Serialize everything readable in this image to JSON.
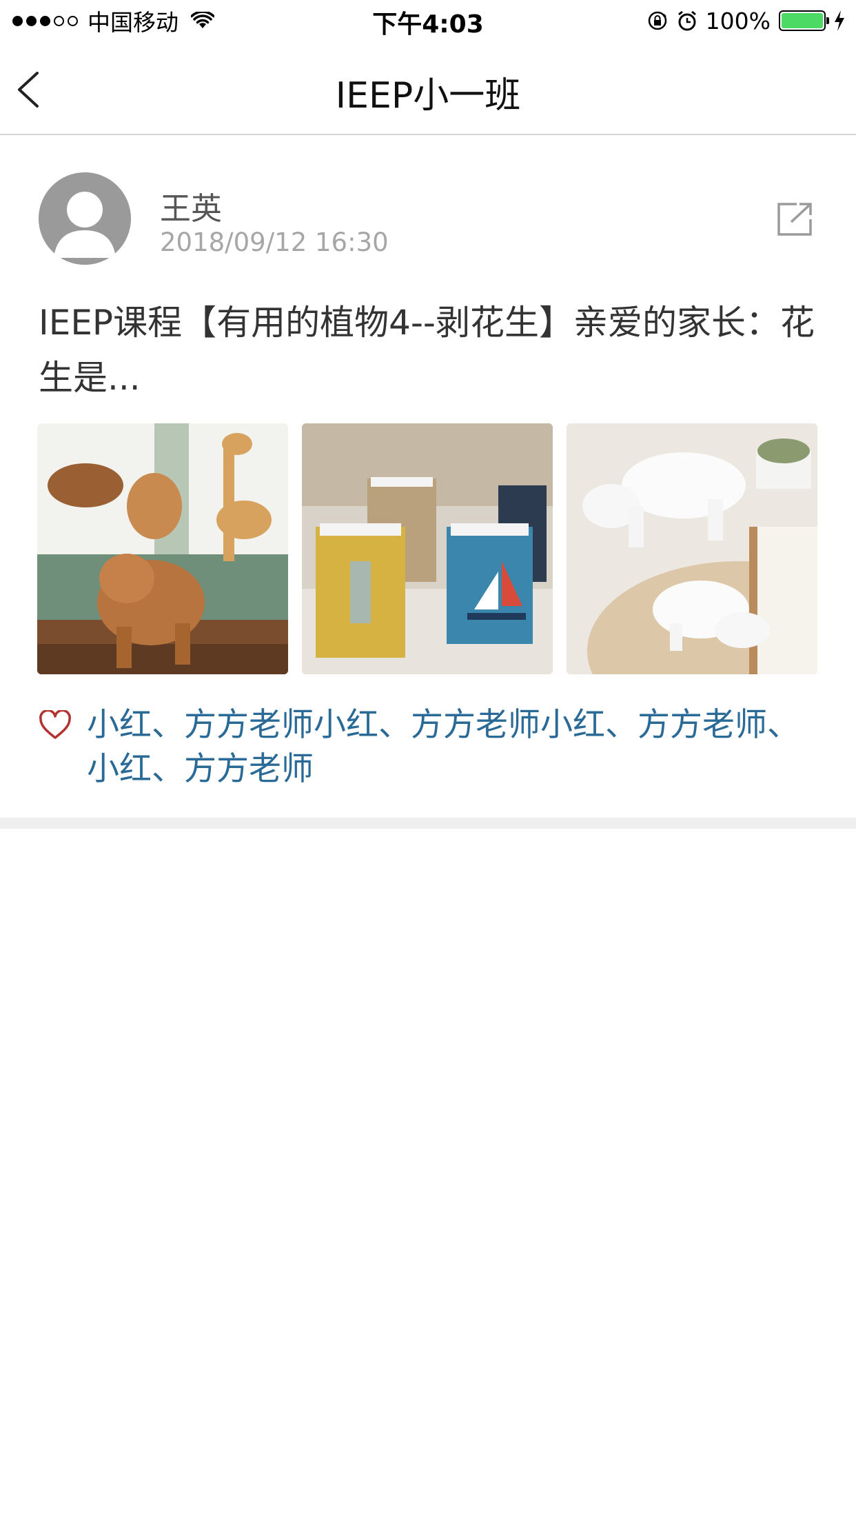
{
  "status_bar": {
    "carrier": "中国移动",
    "time": "下午4:03",
    "battery_percent": "100%",
    "battery_level": 1.0,
    "signal_bars": 3,
    "signal_total": 5,
    "icons": [
      "wifi-icon",
      "rotation-lock-icon",
      "alarm-icon",
      "battery-icon",
      "charging-icon"
    ],
    "battery_color": "#4cd964"
  },
  "navbar": {
    "title": "IEEP小一班",
    "back_icon": "chevron-left-icon"
  },
  "post": {
    "author": "王英",
    "timestamp": "2018/09/12 16:30",
    "text": "IEEP课程【有用的植物4--剥花生】亲爱的家长：花生是...",
    "share_icon": "share-external-icon",
    "photos": [
      {
        "subject": "wooden carved bear and giraffe figurines"
      },
      {
        "subject": "rope-wrapped pen holders with sailboat and anchor"
      },
      {
        "subject": "white ceramic polar bear figurines"
      }
    ],
    "like_icon": "heart-outline-icon",
    "likes_text": "小红、方方老师小红、方方老师小红、方方老师、小红、方方老师"
  },
  "colors": {
    "link": "#2a6a97",
    "heart": "#b3312f",
    "divider": "#efefef"
  }
}
